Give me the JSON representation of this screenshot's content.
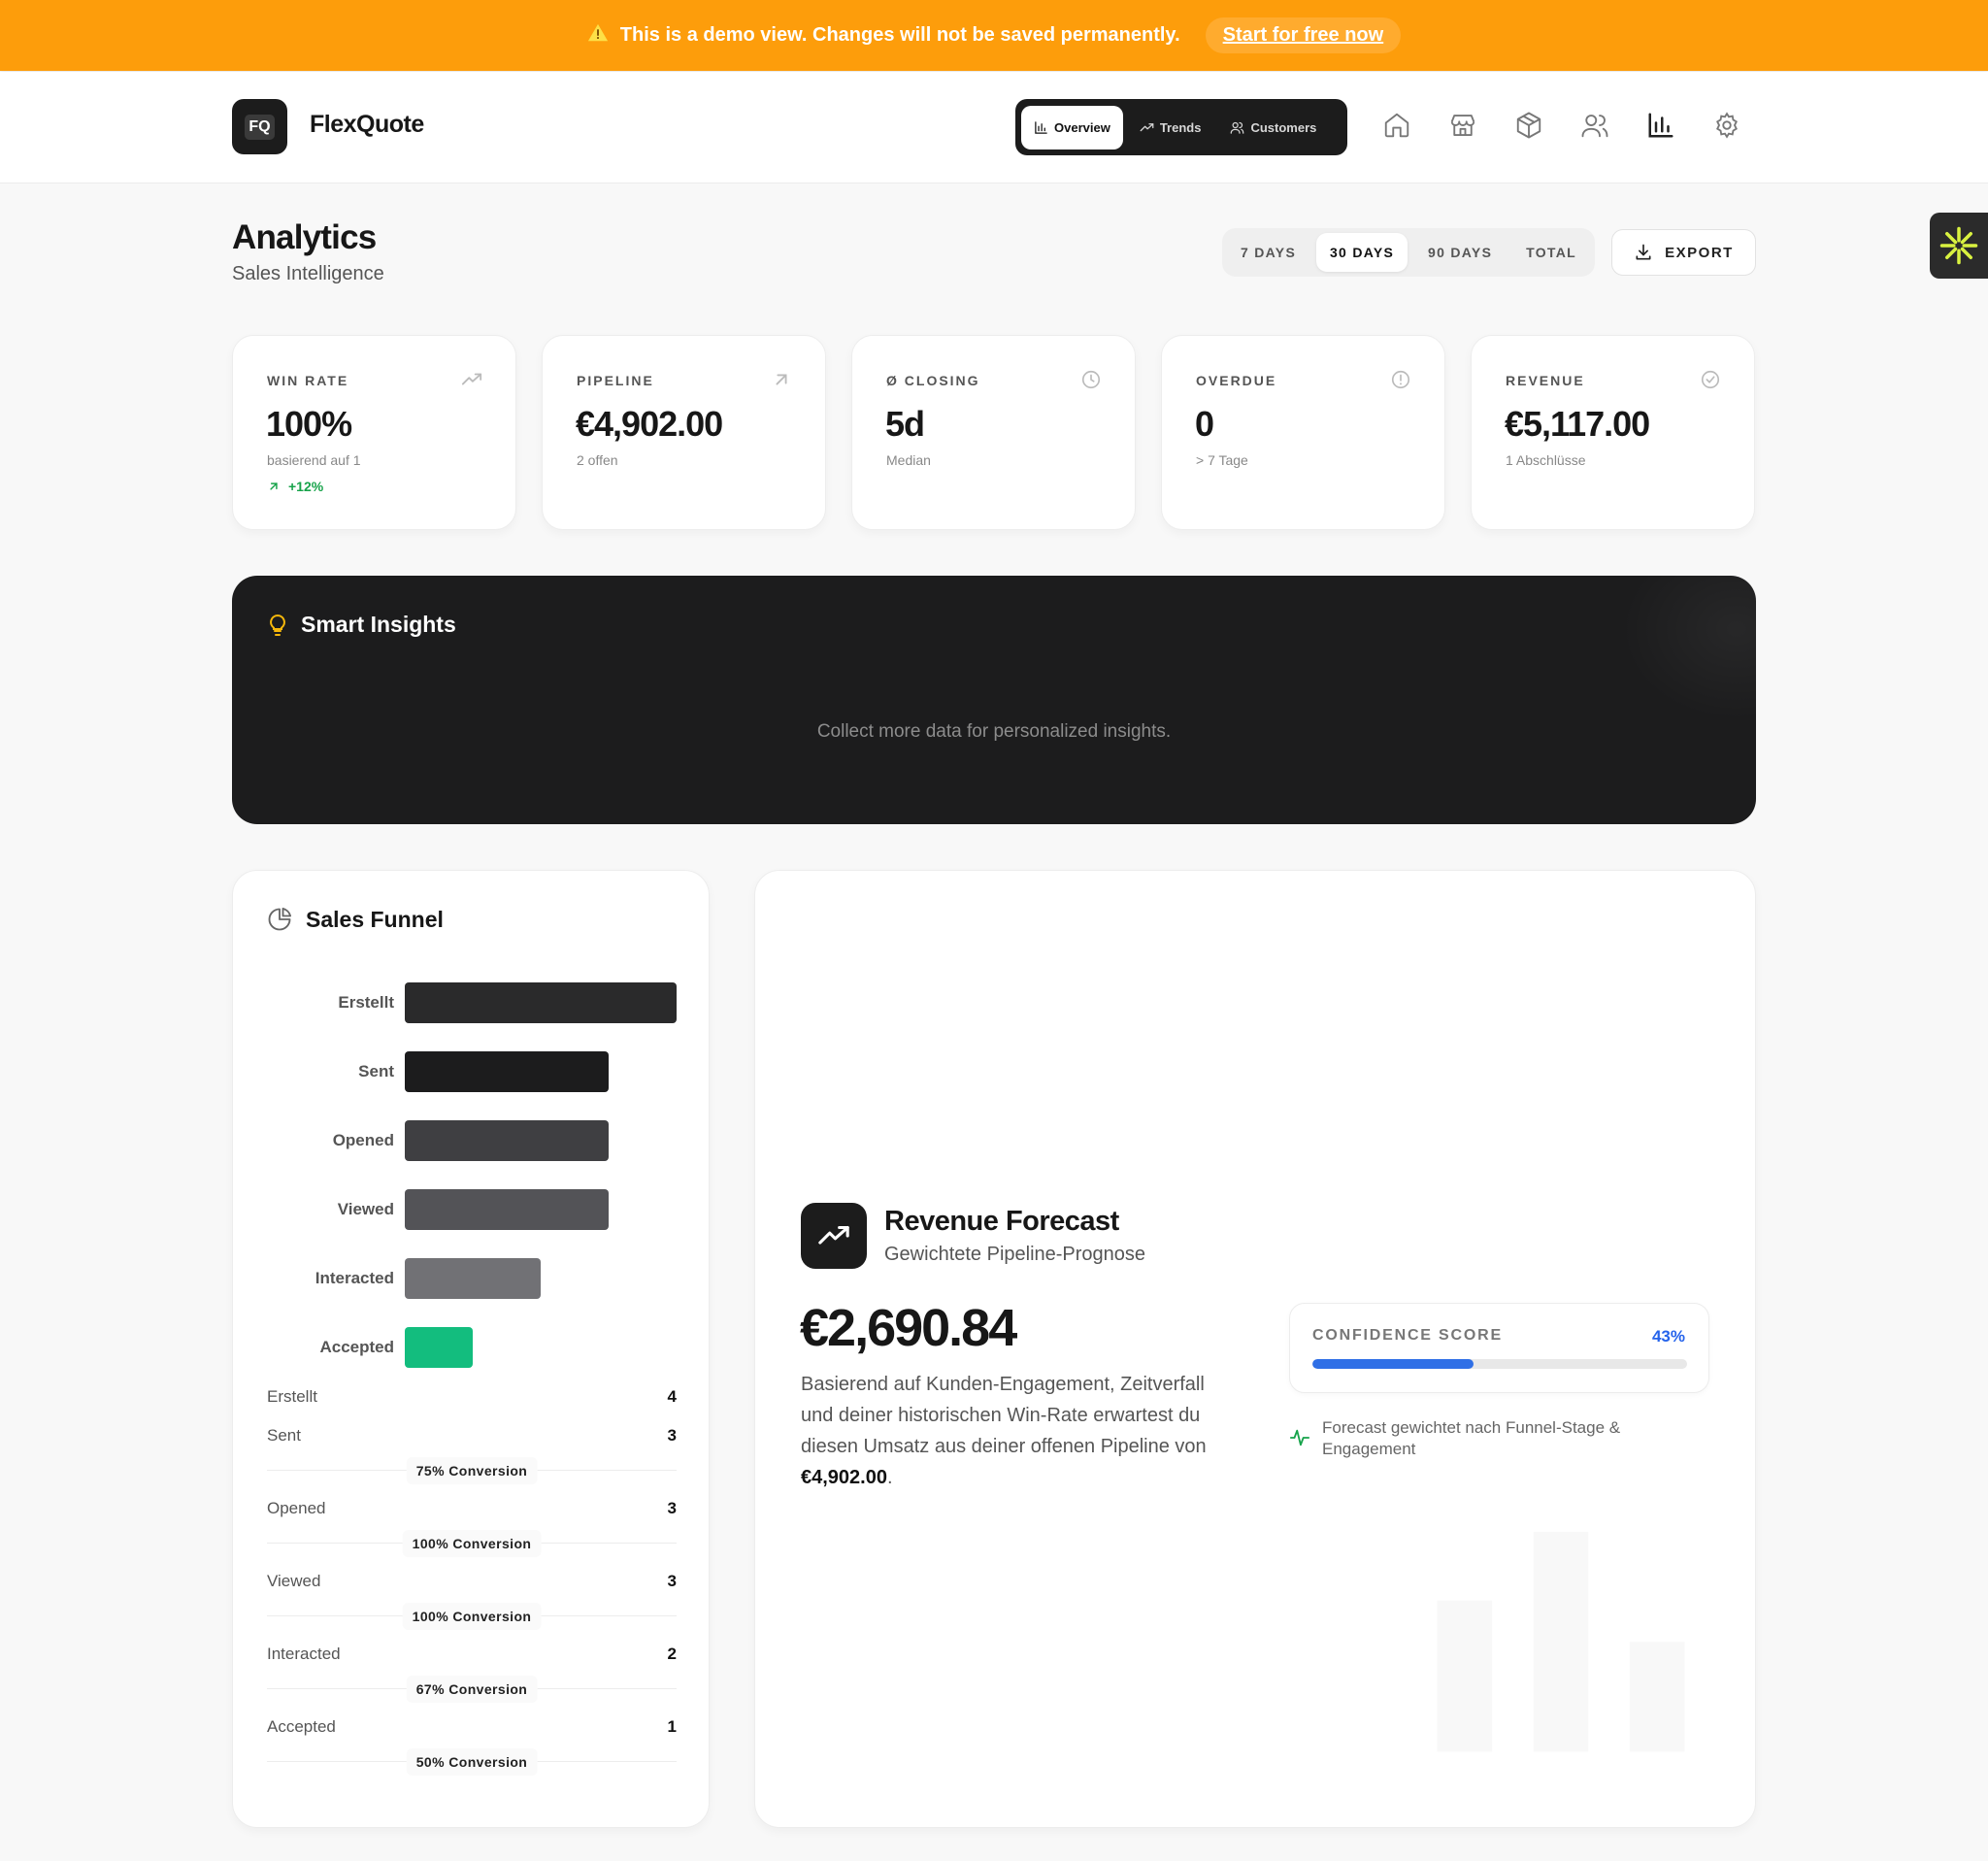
{
  "banner": {
    "message": "This is a demo view. Changes will not be saved permanently.",
    "cta": "Start for free now",
    "color": "#fd9d0b"
  },
  "header": {
    "logo_text": "FQ",
    "brand": "FlexQuote",
    "tabs": [
      {
        "label": "Overview",
        "icon": "bar-chart-icon",
        "active": true
      },
      {
        "label": "Trends",
        "icon": "trend-icon",
        "active": false
      },
      {
        "label": "Customers",
        "icon": "users-icon",
        "active": false
      }
    ],
    "nav_icons": [
      "home-icon",
      "store-icon",
      "box-icon",
      "users-icon",
      "bar-chart-icon",
      "gear-icon"
    ]
  },
  "page": {
    "title": "Analytics",
    "subtitle": "Sales Intelligence",
    "ranges": [
      "7 DAYS",
      "30 DAYS",
      "90 DAYS",
      "TOTAL"
    ],
    "active_range": "30 DAYS",
    "export_label": "EXPORT"
  },
  "kpis": [
    {
      "label": "WIN RATE",
      "value": "100%",
      "sub": "basierend auf 1",
      "trend": "+12%",
      "icon": "trend-up-icon"
    },
    {
      "label": "PIPELINE",
      "value": "€4,902.00",
      "sub": "2 offen",
      "icon": "arrow-up-right-icon"
    },
    {
      "label": "Ø CLOSING",
      "value": "5d",
      "sub": "Median",
      "icon": "clock-icon"
    },
    {
      "label": "OVERDUE",
      "value": "0",
      "sub": "> 7 Tage",
      "icon": "alert-circle-icon"
    },
    {
      "label": "REVENUE",
      "value": "€5,117.00",
      "sub": "1 Abschlüsse",
      "icon": "check-circle-icon"
    }
  ],
  "insights": {
    "title": "Smart Insights",
    "empty": "Collect more data for personalized insights.",
    "icon": "lightbulb-icon"
  },
  "funnel": {
    "title": "Sales Funnel",
    "icon": "pie-chart-icon",
    "stages": [
      {
        "label": "Erstellt",
        "count": "4",
        "value": 4,
        "color": "#2a2a2b",
        "conversion": ""
      },
      {
        "label": "Sent",
        "count": "3",
        "value": 3,
        "color": "#1c1c1d",
        "conversion": "75% Conversion"
      },
      {
        "label": "Opened",
        "count": "3",
        "value": 3,
        "color": "#3f3f42",
        "conversion": "100% Conversion"
      },
      {
        "label": "Viewed",
        "count": "3",
        "value": 3,
        "color": "#535357",
        "conversion": "100% Conversion"
      },
      {
        "label": "Interacted",
        "count": "2",
        "value": 2,
        "color": "#717175",
        "conversion": "67% Conversion"
      },
      {
        "label": "Accepted",
        "count": "1",
        "value": 1,
        "color": "#13bd7e",
        "conversion": "50% Conversion"
      }
    ]
  },
  "forecast": {
    "title": "Revenue Forecast",
    "subtitle": "Gewichtete Pipeline-Prognose",
    "value": "€2,690.84",
    "description": "Basierend auf Kunden-Engagement, Zeitverfall und deiner historischen Win-Rate erwartest du diesen Umsatz aus deiner offenen Pipeline von",
    "pipeline_value": "€4,902.00",
    "confidence_label": "CONFIDENCE SCORE",
    "confidence_text": "43%",
    "confidence_value": 0.43,
    "confidence_color": "#2f6fe6",
    "note": "Forecast gewichtet nach Funnel-Stage & Engagement",
    "note_icon": "activity-icon"
  }
}
